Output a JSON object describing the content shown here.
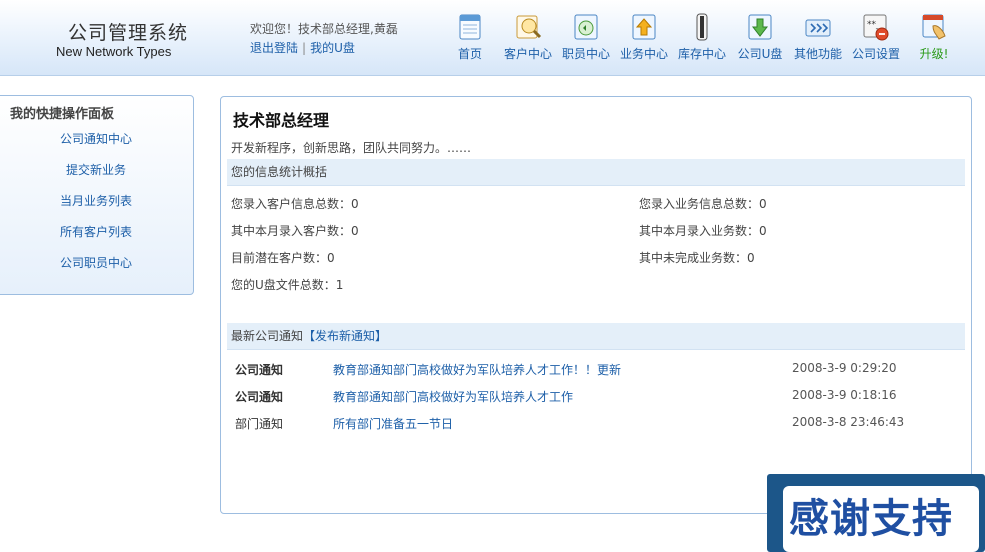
{
  "header": {
    "app_title": "公司管理系统",
    "app_subtitle": "New Network Types",
    "welcome": "欢迎您！技术部总经理,黄磊",
    "logout": "退出登陆",
    "separator": "|",
    "my_disk": "我的U盘"
  },
  "nav": [
    {
      "label": "首页",
      "icon": "home-icon"
    },
    {
      "label": "客户中心",
      "icon": "customer-icon"
    },
    {
      "label": "职员中心",
      "icon": "staff-icon"
    },
    {
      "label": "业务中心",
      "icon": "business-icon"
    },
    {
      "label": "库存中心",
      "icon": "inventory-icon"
    },
    {
      "label": "公司U盘",
      "icon": "udisk-icon"
    },
    {
      "label": "其他功能",
      "icon": "other-icon"
    },
    {
      "label": "公司设置",
      "icon": "settings-icon"
    },
    {
      "label": "升级!",
      "icon": "upgrade-icon"
    }
  ],
  "sidebar": {
    "title": "我的快捷操作面板",
    "items": [
      "公司通知中心",
      "提交新业务",
      "当月业务列表",
      "所有客户列表",
      "公司职员中心"
    ]
  },
  "main": {
    "title": "技术部总经理",
    "motto": "开发新程序，创新思路，团队共同努力。……",
    "stats_heading": "您的信息统计概括",
    "stats_left": [
      "您录入客户信息总数：0",
      "其中本月录入客户数：0",
      "目前潜在客户数：0",
      "您的U盘文件总数：1"
    ],
    "stats_right": [
      "您录入业务信息总数：0",
      "其中本月录入业务数：0",
      "其中未完成业务数：0"
    ],
    "notice_heading": "最新公司通知",
    "publish_link": "【发布新通知】",
    "notices": [
      {
        "type": "公司通知",
        "title": "教育部通知部门高校做好为军队培养人才工作！！更新",
        "date": "2008-3-9 0:29:20"
      },
      {
        "type": "公司通知",
        "title": "教育部通知部门高校做好为军队培养人才工作",
        "date": "2008-3-9 0:18:16"
      },
      {
        "type": "部门通知",
        "title": "所有部门准备五一节日",
        "date": "2008-3-8 23:46:43"
      }
    ]
  },
  "badge": {
    "text": "感谢支持"
  },
  "colors": {
    "link": "#1d5fa8",
    "upgrade": "#2a9a18",
    "bar": "#e4eff9",
    "border": "#9dbde0",
    "badge_bg": "#1c5689"
  }
}
